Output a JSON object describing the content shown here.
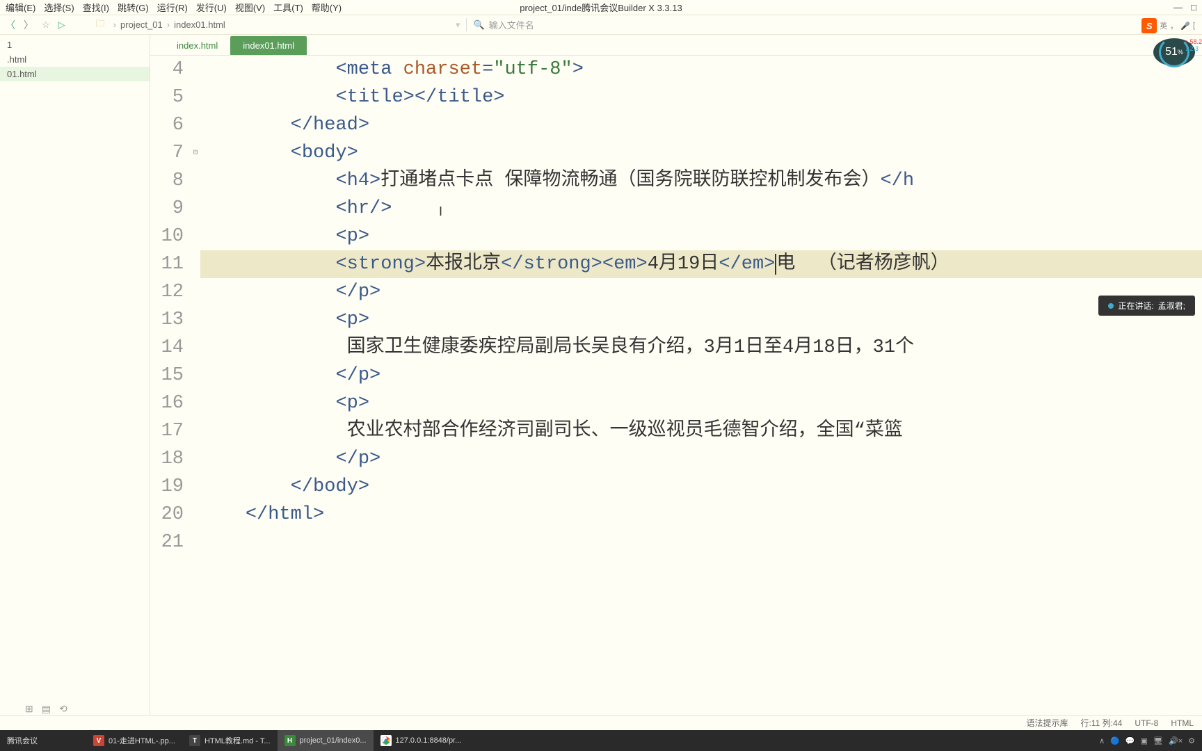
{
  "menubar": {
    "items": [
      "编辑(E)",
      "选择(S)",
      "查找(I)",
      "跳转(G)",
      "运行(R)",
      "发行(U)",
      "视图(V)",
      "工具(T)",
      "帮助(Y)"
    ],
    "title_prefix": "project_01/inde",
    "title_meeting": "腾讯会议",
    "title_suffix": "Builder X 3.3.13"
  },
  "toolbar": {
    "breadcrumb": [
      "project_01",
      "index01.html"
    ],
    "search_placeholder": "输入文件名"
  },
  "ime": {
    "letter": "S",
    "lang": "英",
    "punct": "，"
  },
  "sidebar": {
    "items": [
      "1",
      ".html",
      "01.html"
    ]
  },
  "tabs": [
    {
      "label": "index.html",
      "active": false
    },
    {
      "label": "index01.html",
      "active": true
    }
  ],
  "editor": {
    "lines": [
      {
        "n": 4,
        "indent": "            ",
        "tokens": [
          [
            "tag",
            "<meta"
          ],
          [
            "text",
            " "
          ],
          [
            "attr",
            "charset"
          ],
          [
            "tag",
            "="
          ],
          [
            "attr-val",
            "\"utf-8\""
          ],
          [
            "tag",
            ">"
          ]
        ]
      },
      {
        "n": 5,
        "indent": "            ",
        "tokens": [
          [
            "tag",
            "<title></title>"
          ]
        ]
      },
      {
        "n": 6,
        "indent": "        ",
        "tokens": [
          [
            "tag",
            "</head>"
          ]
        ]
      },
      {
        "n": 7,
        "indent": "        ",
        "fold": "⊟",
        "tokens": [
          [
            "tag",
            "<body>"
          ]
        ]
      },
      {
        "n": 8,
        "indent": "            ",
        "tokens": [
          [
            "tag",
            "<h4>"
          ],
          [
            "text",
            "打通堵点卡点 保障物流畅通（国务院联防联控机制发布会）"
          ],
          [
            "tag",
            "</h"
          ]
        ]
      },
      {
        "n": 9,
        "indent": "            ",
        "tokens": [
          [
            "tag",
            "<hr/>"
          ]
        ]
      },
      {
        "n": 10,
        "indent": "            ",
        "tokens": [
          [
            "tag",
            "<p>"
          ]
        ]
      },
      {
        "n": 11,
        "indent": "            ",
        "highlight": true,
        "tokens": [
          [
            "tag",
            "<strong>"
          ],
          [
            "text",
            "本报北京"
          ],
          [
            "tag",
            "</strong><em>"
          ],
          [
            "text",
            "4月19日"
          ],
          [
            "tag",
            "</em>"
          ],
          [
            "cursor",
            ""
          ],
          [
            "text",
            "电  （记者杨彦帆）"
          ]
        ]
      },
      {
        "n": 12,
        "indent": "            ",
        "tokens": [
          [
            "tag",
            "</p>"
          ]
        ]
      },
      {
        "n": 13,
        "indent": "            ",
        "tokens": [
          [
            "tag",
            "<p>"
          ]
        ]
      },
      {
        "n": 14,
        "indent": "             ",
        "tokens": [
          [
            "text",
            "国家卫生健康委疾控局副局长吴良有介绍，3月1日至4月18日，31个"
          ]
        ]
      },
      {
        "n": 15,
        "indent": "            ",
        "tokens": [
          [
            "tag",
            "</p>"
          ]
        ]
      },
      {
        "n": 16,
        "indent": "            ",
        "tokens": [
          [
            "tag",
            "<p>"
          ]
        ]
      },
      {
        "n": 17,
        "indent": "             ",
        "tokens": [
          [
            "text",
            "农业农村部合作经济司副司长、一级巡视员毛德智介绍，全国“菜篮"
          ]
        ]
      },
      {
        "n": 18,
        "indent": "            ",
        "tokens": [
          [
            "tag",
            "</p>"
          ]
        ]
      },
      {
        "n": 19,
        "indent": "        ",
        "tokens": [
          [
            "tag",
            "</body>"
          ]
        ]
      },
      {
        "n": 20,
        "indent": "    ",
        "tokens": [
          [
            "tag",
            "</html>"
          ]
        ]
      },
      {
        "n": 21,
        "indent": "",
        "tokens": []
      }
    ]
  },
  "net_badge": {
    "percent": "51",
    "unit": "%",
    "up": "58.2",
    "down": "2.3"
  },
  "speaking": {
    "label": "正在讲话:",
    "name": "孟淑君;"
  },
  "statusbar": {
    "syntax": "语法提示库",
    "pos": "行:11 列:44",
    "encoding": "UTF-8",
    "lang": "HTML"
  },
  "taskbar": {
    "left_label": "腾讯会议",
    "items": [
      {
        "icon_bg": "#c43",
        "icon_text": "V",
        "label": "01-走进HTML-.pp..."
      },
      {
        "icon_bg": "#444",
        "icon_text": "T",
        "label": "HTML教程.md - T..."
      },
      {
        "icon_bg": "#3a8a3a",
        "icon_text": "H",
        "label": "project_01/index0...",
        "active": true
      },
      {
        "icon_bg": "#fff",
        "icon_text": "",
        "label": "127.0.0.1:8848/pr...",
        "chrome": true
      }
    ]
  }
}
